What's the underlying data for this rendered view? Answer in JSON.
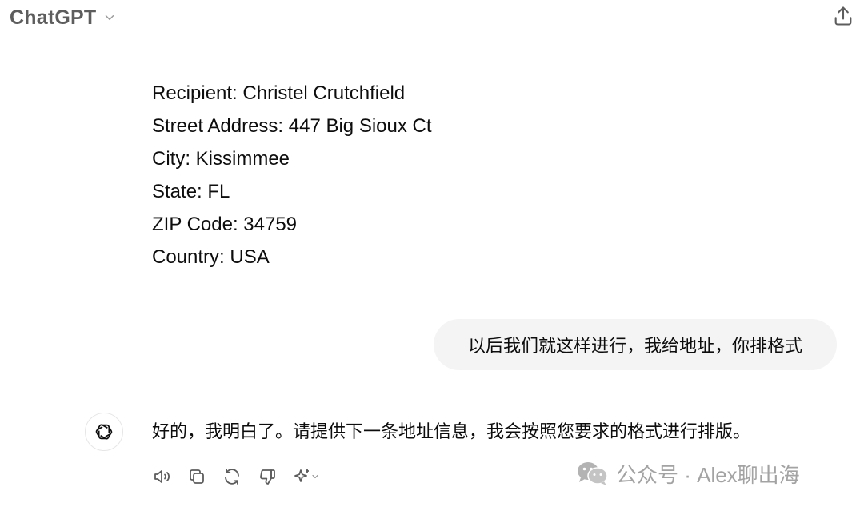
{
  "header": {
    "model_name": "ChatGPT",
    "icons": {
      "chevron": "chevron-down-icon",
      "share": "share-upload-icon"
    }
  },
  "conversation": {
    "previous_assistant": {
      "lines": [
        "Recipient: Christel Crutchfield",
        "Street Address: 447 Big Sioux Ct",
        "City: Kissimmee",
        "State: FL",
        "ZIP Code: 34759",
        "Country: USA"
      ]
    },
    "user_message": "以后我们就这样进行，我给地址，你排格式",
    "assistant_reply": "好的，我明白了。请提供下一条地址信息，我会按照您要求的格式进行排版。",
    "action_icons": [
      "read-aloud-icon",
      "copy-icon",
      "regenerate-icon",
      "thumbs-down-icon",
      "sparkle-icon"
    ]
  },
  "watermark": {
    "text": "公众号 · Alex聊出海",
    "icon": "wechat-logo-icon"
  },
  "colors": {
    "text": "#0d0d0d",
    "muted": "#5d5d5d",
    "bubble": "#f4f4f4",
    "watermark": "#a3a3a3"
  }
}
